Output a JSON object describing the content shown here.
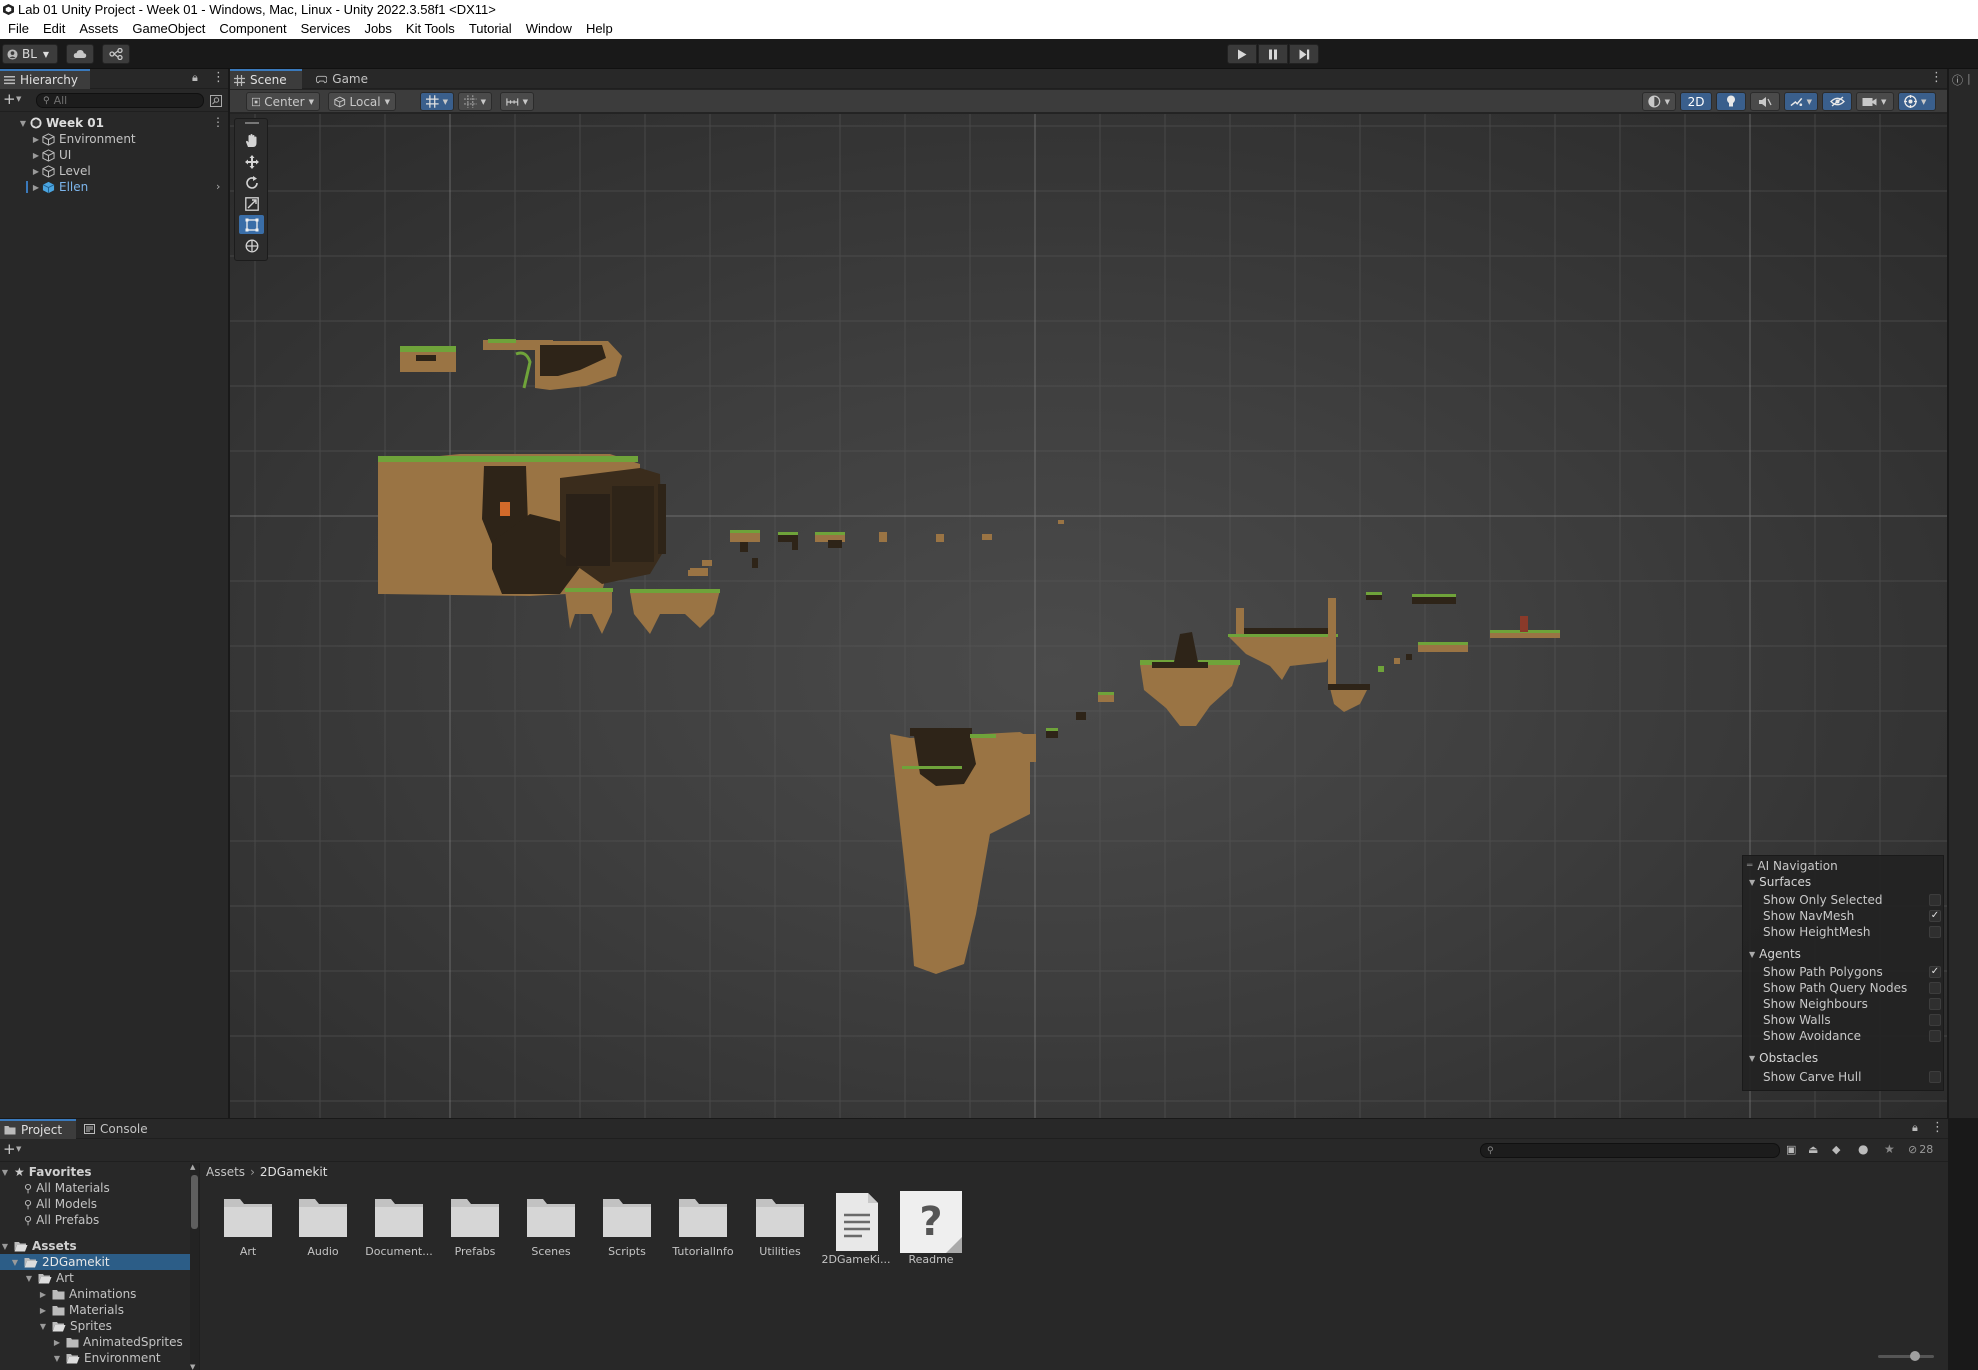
{
  "window": {
    "title": "Lab 01 Unity Project - Week 01 - Windows, Mac, Linux - Unity 2022.3.58f1 <DX11>"
  },
  "menu": [
    "File",
    "Edit",
    "Assets",
    "GameObject",
    "Component",
    "Services",
    "Jobs",
    "Kit Tools",
    "Tutorial",
    "Window",
    "Help"
  ],
  "toolbar": {
    "account": "BL",
    "account_icon": "account-icon",
    "cloud_icon": "cloud-icon",
    "collab_icon": "version-control-icon",
    "play_icon": "play-icon",
    "pause_icon": "pause-icon",
    "step_icon": "step-icon"
  },
  "hierarchy": {
    "tab": "Hierarchy",
    "search_placeholder": "All",
    "scene": "Week 01",
    "items": [
      {
        "label": "Environment",
        "selected": false
      },
      {
        "label": "UI",
        "selected": false
      },
      {
        "label": "Level",
        "selected": false
      },
      {
        "label": "Ellen",
        "selected": true
      }
    ]
  },
  "scene_view": {
    "tabs": [
      "Scene",
      "Game"
    ],
    "active_tab": "Scene",
    "pivot_mode": "Center",
    "pivot_rotation": "Local",
    "mode_2d": "2D",
    "tools": [
      "hand-tool-icon",
      "move-tool-icon",
      "rotate-tool-icon",
      "scale-tool-icon",
      "rect-tool-icon",
      "transform-tool-icon"
    ],
    "selected_tool": "rect-tool-icon"
  },
  "ai_navigation": {
    "title": "AI Navigation",
    "sections": [
      {
        "name": "Surfaces",
        "options": [
          {
            "label": "Show Only Selected",
            "checked": false
          },
          {
            "label": "Show NavMesh",
            "checked": true
          },
          {
            "label": "Show HeightMesh",
            "checked": false
          }
        ]
      },
      {
        "name": "Agents",
        "options": [
          {
            "label": "Show Path Polygons",
            "checked": true
          },
          {
            "label": "Show Path Query Nodes",
            "checked": false
          },
          {
            "label": "Show Neighbours",
            "checked": false
          },
          {
            "label": "Show Walls",
            "checked": false
          },
          {
            "label": "Show Avoidance",
            "checked": false
          }
        ]
      },
      {
        "name": "Obstacles",
        "options": [
          {
            "label": "Show Carve Hull",
            "checked": false
          }
        ]
      }
    ]
  },
  "project": {
    "tabs": [
      "Project",
      "Console"
    ],
    "active_tab": "Project",
    "hidden_count": "28",
    "breadcrumb": [
      "Assets",
      "2DGamekit"
    ],
    "favorites_label": "Favorites",
    "favorites": [
      "All Materials",
      "All Models",
      "All Prefabs"
    ],
    "tree": [
      {
        "label": "Assets",
        "depth": 0,
        "expanded": true,
        "bold": true
      },
      {
        "label": "2DGamekit",
        "depth": 1,
        "expanded": true,
        "selected": true
      },
      {
        "label": "Art",
        "depth": 2,
        "expanded": true
      },
      {
        "label": "Animations",
        "depth": 3,
        "expanded": false
      },
      {
        "label": "Materials",
        "depth": 3,
        "expanded": false
      },
      {
        "label": "Sprites",
        "depth": 3,
        "expanded": true
      },
      {
        "label": "AnimatedSprites",
        "depth": 4,
        "expanded": false
      },
      {
        "label": "Environment",
        "depth": 4,
        "expanded": true
      }
    ],
    "assets": [
      {
        "label": "Art",
        "kind": "folder-icon"
      },
      {
        "label": "Audio",
        "kind": "folder-icon"
      },
      {
        "label": "Document...",
        "kind": "folder-icon"
      },
      {
        "label": "Prefabs",
        "kind": "folder-icon"
      },
      {
        "label": "Scenes",
        "kind": "folder-icon"
      },
      {
        "label": "Scripts",
        "kind": "folder-icon"
      },
      {
        "label": "TutorialInfo",
        "kind": "folder-icon"
      },
      {
        "label": "Utilities",
        "kind": "folder-icon"
      },
      {
        "label": "2DGameKi...",
        "kind": "text-file-icon"
      },
      {
        "label": "Readme",
        "kind": "unknown-file-icon"
      }
    ]
  },
  "colors": {
    "accent": "#3a79bb",
    "selection": "#2c5d87",
    "panel": "#282828",
    "viewport": "#444444",
    "grass": "#6fa33a",
    "dirt": "#9a7444",
    "cave": "#2e2418"
  }
}
